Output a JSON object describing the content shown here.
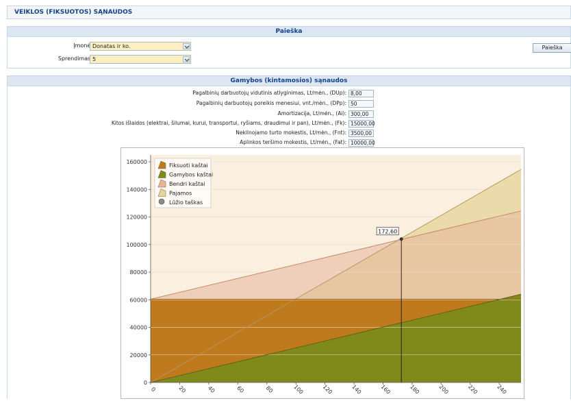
{
  "page": {
    "title": "VEIKLOS (FIKSUOTOS) SĄNAUDOS"
  },
  "search": {
    "title": "Paieška",
    "company_label": "Įmonė:",
    "company_value": "Donatas ir ko.",
    "decision_label": "Sprendimas:",
    "decision_value": "5",
    "button_label": "Paieška"
  },
  "production": {
    "title": "Gamybos (kintamosios) sąnaudos",
    "params": [
      {
        "label": "Pagalbinių darbuotojų vidutinis atlyginimas, Lt/mėn., (DUp):",
        "value": "8,00"
      },
      {
        "label": "Pagalbinių darbuotojų poreikis menesiui, vnt./mėn., (DPp):",
        "value": "50"
      },
      {
        "label": "Amortizacija, Lt/mėn., (Ai):",
        "value": "300,00"
      },
      {
        "label": "Kitos išlaidos (elektrai, šilumai, kurui, transportui, ryšiams, draudimui ir pan), Lt/mėn., (Fk):",
        "value": "15000,00"
      },
      {
        "label": "Nekilnojamo turto mokestis, Lt/mėn., (Fnt):",
        "value": "3500,00"
      },
      {
        "label": "Aplinkos teršimo mokestis, Lt/mėn., (Fat):",
        "value": "10000,00"
      }
    ]
  },
  "colors": {
    "fixed": "#c07a1e",
    "production": "#7f8a1a",
    "total": "#e8b49a",
    "revenue": "#e6d49a",
    "panel_title": "#15428b"
  },
  "chart_data": {
    "type": "area",
    "x_ticks": [
      "0",
      "20",
      "40",
      "60",
      "80",
      "100",
      "120",
      "140",
      "160",
      "180",
      "200",
      "220",
      "240"
    ],
    "y_ticks": [
      "0",
      "20000",
      "40000",
      "60000",
      "80000",
      "100000",
      "120000",
      "140000",
      "160000"
    ],
    "xlim": [
      0,
      255
    ],
    "ylim": [
      0,
      165000
    ],
    "legend_position": "top-left",
    "legend": [
      {
        "name": "Fiksuoti kaštai",
        "icon": "fixed-costs-icon"
      },
      {
        "name": "Gamybos kaštai",
        "icon": "production-costs-icon"
      },
      {
        "name": "Bendri kaštai",
        "icon": "total-costs-icon"
      },
      {
        "name": "Pajamos",
        "icon": "revenue-icon"
      },
      {
        "name": "Lūžio taškas",
        "icon": "break-even-icon"
      }
    ],
    "series": [
      {
        "name": "Fiksuoti kaštai",
        "x": [
          0,
          255
        ],
        "y": [
          60400,
          60400
        ]
      },
      {
        "name": "Gamybos kaštai",
        "x": [
          0,
          255
        ],
        "y": [
          0,
          64000
        ]
      },
      {
        "name": "Bendri kaštai",
        "x": [
          0,
          255
        ],
        "y": [
          60400,
          124400
        ]
      },
      {
        "name": "Pajamos",
        "x": [
          0,
          255
        ],
        "y": [
          0,
          154500
        ]
      }
    ],
    "break_even": {
      "x": 172.6,
      "y": 104000,
      "label": "172,60"
    }
  }
}
